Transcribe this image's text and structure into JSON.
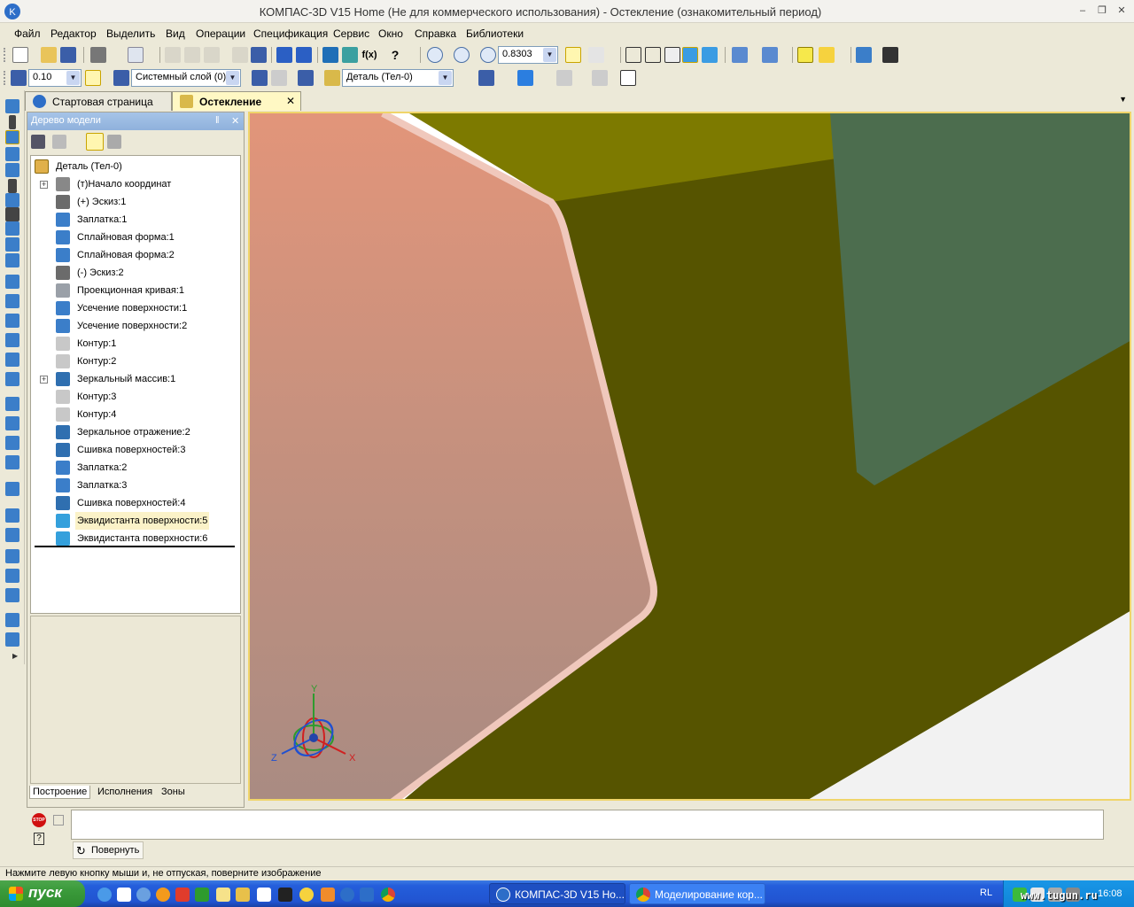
{
  "window": {
    "title": "КОМПАС-3D V15 Home (Не для коммерческого использования) - Остекление (ознакомительный период)"
  },
  "menu": [
    "Файл",
    "Редактор",
    "Выделить",
    "Вид",
    "Операции",
    "Спецификация",
    "Сервис",
    "Окно",
    "Справка",
    "Библиотеки"
  ],
  "toolbar": {
    "zoom_value": "0.8303",
    "step_value": "0.10",
    "layer_value": "Системный слой (0)",
    "part_value": "Деталь (Тел-0)",
    "fx_label": "f(x)"
  },
  "tabs": [
    {
      "label": "Стартовая страница",
      "active": false
    },
    {
      "label": "Остекление",
      "active": true
    }
  ],
  "tree": {
    "header": "Дерево модели",
    "pin": "‖",
    "close": "✕",
    "root": "Деталь (Тел-0)",
    "items": [
      {
        "label": "(т)Начало координат",
        "icon": "origin-icon",
        "expand": true
      },
      {
        "label": "(+) Эскиз:1",
        "icon": "sketch-icon"
      },
      {
        "label": "Заплатка:1",
        "icon": "patch-icon"
      },
      {
        "label": "Сплайновая форма:1",
        "icon": "spline-icon"
      },
      {
        "label": "Сплайновая форма:2",
        "icon": "spline-icon"
      },
      {
        "label": "(-) Эскиз:2",
        "icon": "sketch-icon"
      },
      {
        "label": "Проекционная кривая:1",
        "icon": "projection-curve-icon"
      },
      {
        "label": "Усечение поверхности:1",
        "icon": "trim-icon"
      },
      {
        "label": "Усечение поверхности:2",
        "icon": "trim-icon"
      },
      {
        "label": "Контур:1",
        "icon": "contour-icon"
      },
      {
        "label": "Контур:2",
        "icon": "contour-icon"
      },
      {
        "label": "Зеркальный массив:1",
        "icon": "mirror-array-icon",
        "expand": true
      },
      {
        "label": "Контур:3",
        "icon": "contour-icon"
      },
      {
        "label": "Контур:4",
        "icon": "contour-icon"
      },
      {
        "label": "Зеркальное отражение:2",
        "icon": "mirror-icon"
      },
      {
        "label": "Сшивка поверхностей:3",
        "icon": "stitch-icon"
      },
      {
        "label": "Заплатка:2",
        "icon": "patch-icon"
      },
      {
        "label": "Заплатка:3",
        "icon": "patch-icon"
      },
      {
        "label": "Сшивка поверхностей:4",
        "icon": "stitch-icon"
      },
      {
        "label": "Эквидистанта поверхности:5",
        "icon": "offset-surface-icon",
        "selected": true
      },
      {
        "label": "Эквидистанта поверхности:6",
        "icon": "offset-surface-icon"
      }
    ],
    "panel_tabs": [
      "Построение",
      "Исполнения",
      "Зоны"
    ]
  },
  "axes": {
    "x": "X",
    "y": "Y",
    "z": "Z"
  },
  "command": {
    "rotate_label": "Повернуть",
    "stop_label": "STOP",
    "help_label": "?"
  },
  "status": "Нажмите левую кнопку мыши и, не отпуская, поверните изображение",
  "taskbar": {
    "start": "пуск",
    "tasks": [
      "КОМПАС-3D V15 Ho...",
      "Моделирование кор..."
    ],
    "lang": "RL",
    "clock": "16:08"
  },
  "watermark": "www.tugun.ru",
  "colors": {
    "accent": "#f0d56a",
    "pink_face": "#b08b7e",
    "olive_dark": "#565400",
    "olive_top": "#7d7a00",
    "green_face": "#4c6d4e"
  }
}
